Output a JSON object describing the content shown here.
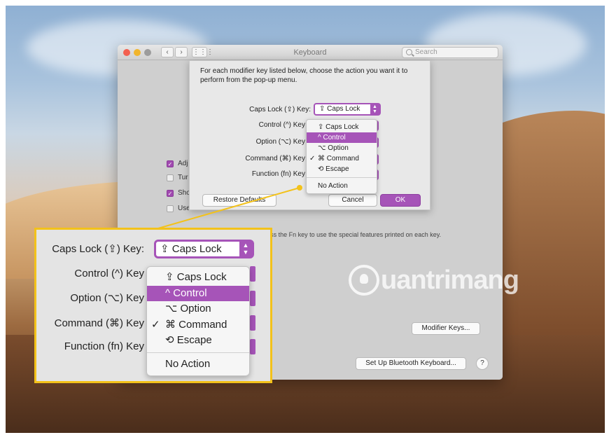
{
  "window": {
    "title": "Keyboard",
    "search_placeholder": "Search",
    "grid_icon": "grid-icon",
    "lights": [
      "#f3604f",
      "#f1b52c",
      "#9c9c9c"
    ]
  },
  "background": {
    "checkboxes": [
      {
        "label": "Adj",
        "checked": true
      },
      {
        "label": "Tur",
        "checked": false
      },
      {
        "label": "Sho",
        "checked": true
      },
      {
        "label": "Use",
        "checked": false
      }
    ],
    "fn_note": "When this option is selected, press the Fn key to use the special features printed on each key.",
    "modifier_keys_button": "Modifier Keys...",
    "bluetooth_button": "Set Up Bluetooth Keyboard...",
    "help": "?"
  },
  "sheet": {
    "description": "For each modifier key listed below, choose the action you want it to perform from the pop-up menu.",
    "rows": [
      {
        "label": "Caps Lock (⇪) Key:"
      },
      {
        "label": "Control (^) Key"
      },
      {
        "label": "Option (⌥) Key"
      },
      {
        "label": "Command (⌘) Key"
      },
      {
        "label": "Function (fn) Key"
      }
    ],
    "popup_value": "⇪ Caps Lock",
    "menu": [
      "⇪ Caps Lock",
      "^ Control",
      "⌥ Option",
      "⌘ Command",
      "⟲ Escape",
      "No Action"
    ],
    "menu_selected_index": 1,
    "menu_checked_index": 3,
    "check_glyph": "✓",
    "restore_button": "Restore Defaults",
    "cancel_button": "Cancel",
    "ok_button": "OK"
  },
  "zoom": {
    "rows": [
      {
        "label": "Caps Lock (⇪) Key:"
      },
      {
        "label": "Control (^) Key"
      },
      {
        "label": "Option (⌥) Key"
      },
      {
        "label": "Command (⌘) Key"
      },
      {
        "label": "Function (fn) Key"
      }
    ],
    "popup_value": "⇪ Caps Lock",
    "menu": [
      "⇪ Caps Lock",
      "^ Control",
      "⌥ Option",
      "⌘ Command",
      "⟲ Escape",
      "No Action"
    ],
    "check_glyph": "✓"
  },
  "colors": {
    "accent": "#a654b8",
    "callout": "#f3c21a"
  },
  "watermark": {
    "text": "uantrimang"
  }
}
